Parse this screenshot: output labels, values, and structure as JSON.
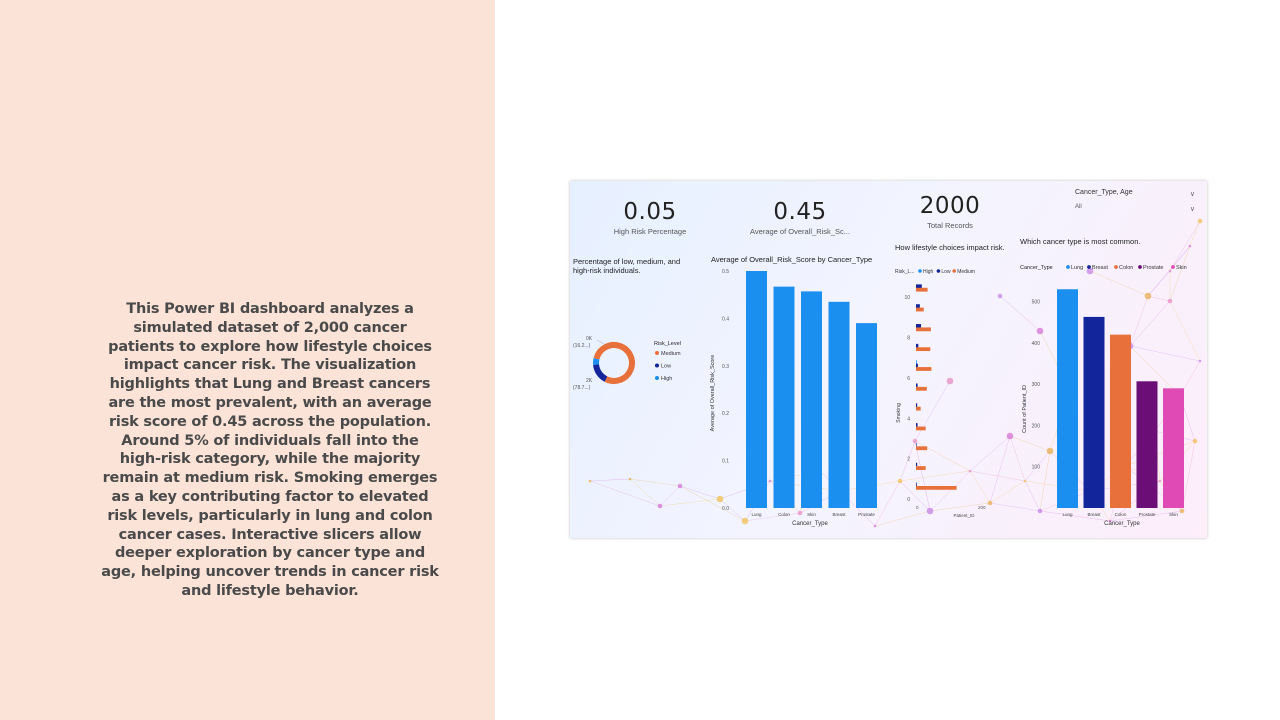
{
  "description": "This Power BI dashboard analyzes a simulated dataset of 2,000 cancer patients to explore how lifestyle choices impact cancer risk. The visualization highlights that Lung and Breast cancers are the most prevalent, with an average risk score of 0.45 across the population. Around 5% of individuals fall into the high-risk category, while the majority remain at medium risk. Smoking emerges as a key contributing factor to elevated risk levels, particularly in lung and colon cancer cases. Interactive slicers allow deeper exploration by cancer type and age, helping uncover trends in cancer risk and lifestyle behavior.",
  "kpis": [
    {
      "value": "0.05",
      "label": "High Risk Percentage"
    },
    {
      "value": "0.45",
      "label": "Average of Overall_Risk_Sc..."
    },
    {
      "value": "2000",
      "label": "Total Records"
    }
  ],
  "slicer": {
    "label": "Cancer_Type, Age",
    "value": "All"
  },
  "colors": {
    "high": "#1a8fef",
    "low": "#13259a",
    "medium": "#e8703a",
    "prostate": "#6b0f77",
    "skin": "#e04ab5",
    "left_bg": "#fbe3d8"
  },
  "chart_data": [
    {
      "type": "pie",
      "title": "Percentage of low, medium, and high-risk individuals.",
      "legend_title": "Risk_Level",
      "legend": [
        "Medium",
        "Low",
        "High"
      ],
      "labels": [
        "0K (16.2...)",
        "2K (78.7...)"
      ],
      "values": [
        78.7,
        16.2,
        5.1
      ]
    },
    {
      "type": "bar",
      "title": "Average of Overall_Risk_Score by Cancer_Type",
      "xlabel": "Cancer_Type",
      "ylabel": "Average of Overall_Risk_Score",
      "categories": [
        "Lung",
        "Colon",
        "Skin",
        "Breast",
        "Prostate"
      ],
      "values": [
        0.5,
        0.467,
        0.457,
        0.435,
        0.39
      ],
      "yticks": [
        "0.0",
        "0.1",
        "0.2",
        "0.3",
        "0.4",
        "0.5"
      ],
      "ylim": [
        0,
        0.5
      ]
    },
    {
      "type": "bar",
      "orientation": "horizontal",
      "title": "How lifestyle choices impact risk.",
      "legend_title": "Risk_L...",
      "legend": [
        "High",
        "Low",
        "Medium"
      ],
      "xlabel": "Patient_ID",
      "ylabel": "Smoking",
      "yticks": [
        "0",
        "2",
        "4",
        "6",
        "8",
        "10"
      ],
      "xticks": [
        "0",
        "200"
      ],
      "xlim": [
        0,
        200
      ],
      "series": [
        {
          "name": "High",
          "values": [
            0,
            0,
            0,
            0,
            4,
            0,
            0,
            0,
            0,
            0,
            0
          ]
        },
        {
          "name": "Low",
          "values": [
            30,
            20,
            26,
            12,
            10,
            8,
            6,
            8,
            3,
            6,
            4
          ]
        },
        {
          "name": "Medium",
          "values": [
            60,
            40,
            77,
            74,
            80,
            56,
            24,
            50,
            58,
            50,
            210
          ]
        }
      ]
    },
    {
      "type": "bar",
      "title": "Which cancer type is most common.",
      "legend_title": "Cancer_Type",
      "legend": [
        "Lung",
        "Breast",
        "Colon",
        "Prostate",
        "Skin"
      ],
      "xlabel": "Cancer_Type",
      "ylabel": "Count of Patient_ID",
      "categories": [
        "Lung",
        "Breast",
        "Colon",
        "Prostate",
        "Skin"
      ],
      "values": [
        530,
        463,
        420,
        307,
        290
      ],
      "yticks": [
        "100",
        "200",
        "300",
        "400",
        "500"
      ],
      "ylim": [
        0,
        550
      ]
    }
  ]
}
